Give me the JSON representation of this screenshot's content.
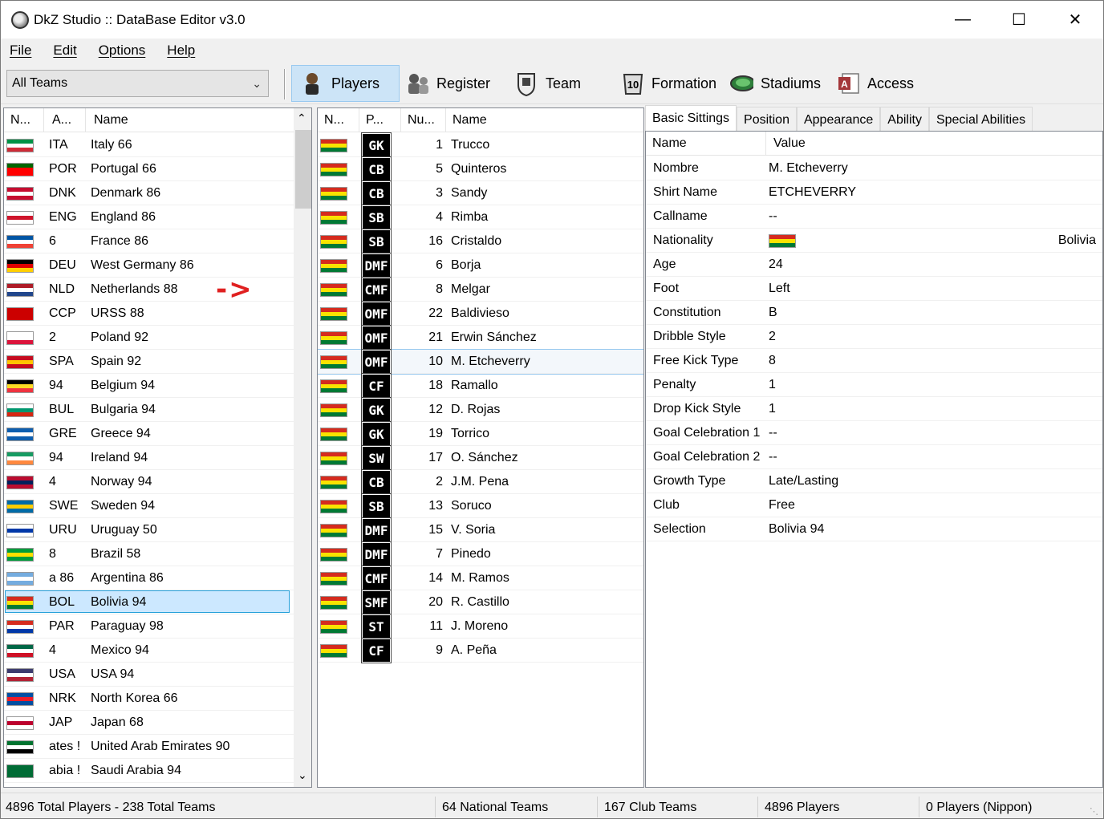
{
  "window": {
    "title": "DkZ Studio :: DataBase Editor v3.0",
    "minimize": "—",
    "maximize": "☐",
    "close": "✕"
  },
  "menu": [
    "File",
    "Edit",
    "Options",
    "Help"
  ],
  "toolbar": {
    "combo_value": "All Teams",
    "buttons": [
      {
        "label": "Players",
        "icon": "player-icon",
        "active": true
      },
      {
        "label": "Register",
        "icon": "register-icon"
      },
      {
        "label": "Team",
        "icon": "team-badge-icon"
      },
      {
        "label": "Formation",
        "icon": "formation-icon"
      },
      {
        "label": "Stadiums",
        "icon": "stadium-icon"
      },
      {
        "label": "Access",
        "icon": "access-icon"
      }
    ]
  },
  "teams": {
    "headers": [
      "N...",
      "A...",
      "Name"
    ],
    "rows": [
      {
        "abbr": "ITA",
        "name": "Italy 66",
        "flag": [
          "#009246",
          "#ffffff",
          "#ce2b37"
        ]
      },
      {
        "abbr": "POR",
        "name": "Portugal 66",
        "flag": [
          "#006600",
          "#ff0000",
          "#ff0000"
        ]
      },
      {
        "abbr": "DNK",
        "name": "Denmark 86",
        "flag": [
          "#c60c30",
          "#ffffff",
          "#c60c30"
        ]
      },
      {
        "abbr": "ENG",
        "name": "England 86",
        "flag": [
          "#ffffff",
          "#cf142b",
          "#ffffff"
        ]
      },
      {
        "abbr": "6",
        "name": "France 86",
        "flag": [
          "#0055a4",
          "#ffffff",
          "#ef4135"
        ]
      },
      {
        "abbr": "DEU",
        "name": "West Germany 86",
        "flag": [
          "#000000",
          "#dd0000",
          "#ffce00"
        ]
      },
      {
        "abbr": "NLD",
        "name": "Netherlands 88",
        "flag": [
          "#ae1c28",
          "#ffffff",
          "#21468b"
        ]
      },
      {
        "abbr": "CCP",
        "name": "URSS 88",
        "flag": [
          "#cc0000",
          "#cc0000",
          "#cc0000"
        ]
      },
      {
        "abbr": "2",
        "name": "Poland 92",
        "flag": [
          "#ffffff",
          "#ffffff",
          "#dc143c"
        ]
      },
      {
        "abbr": "SPA",
        "name": "Spain 92",
        "flag": [
          "#c60b1e",
          "#ffc400",
          "#c60b1e"
        ]
      },
      {
        "abbr": "94",
        "name": "Belgium 94",
        "flag": [
          "#000000",
          "#fdda24",
          "#ef3340"
        ]
      },
      {
        "abbr": "BUL",
        "name": "Bulgaria 94",
        "flag": [
          "#ffffff",
          "#00966e",
          "#d62612"
        ]
      },
      {
        "abbr": "GRE",
        "name": "Greece 94",
        "flag": [
          "#0d5eaf",
          "#ffffff",
          "#0d5eaf"
        ]
      },
      {
        "abbr": "94",
        "name": "Ireland 94",
        "flag": [
          "#169b62",
          "#ffffff",
          "#ff883e"
        ]
      },
      {
        "abbr": "4",
        "name": "Norway 94",
        "flag": [
          "#ba0c2f",
          "#00205b",
          "#ba0c2f"
        ]
      },
      {
        "abbr": "SWE",
        "name": "Sweden 94",
        "flag": [
          "#006aa7",
          "#fecc00",
          "#006aa7"
        ]
      },
      {
        "abbr": "URU",
        "name": "Uruguay 50",
        "flag": [
          "#ffffff",
          "#0038a8",
          "#ffffff"
        ]
      },
      {
        "abbr": "8",
        "name": "Brazil 58",
        "flag": [
          "#009c3b",
          "#ffdf00",
          "#009c3b"
        ]
      },
      {
        "abbr": "a 86",
        "name": "Argentina 86",
        "flag": [
          "#74acdf",
          "#ffffff",
          "#74acdf"
        ]
      },
      {
        "abbr": "BOL",
        "name": "Bolivia 94",
        "flag": [
          "#d52b1e",
          "#f9e300",
          "#007934"
        ],
        "selected": true
      },
      {
        "abbr": "PAR",
        "name": "Paraguay 98",
        "flag": [
          "#d52b1e",
          "#ffffff",
          "#0038a8"
        ]
      },
      {
        "abbr": "4",
        "name": "Mexico 94",
        "flag": [
          "#006847",
          "#ffffff",
          "#ce1126"
        ]
      },
      {
        "abbr": "USA",
        "name": "USA 94",
        "flag": [
          "#3c3b6e",
          "#ffffff",
          "#b22234"
        ]
      },
      {
        "abbr": "NRK",
        "name": "North Korea 66",
        "flag": [
          "#024fa2",
          "#ed1c27",
          "#024fa2"
        ]
      },
      {
        "abbr": "JAP",
        "name": "Japan 68",
        "flag": [
          "#ffffff",
          "#bc002d",
          "#ffffff"
        ]
      },
      {
        "abbr": "ates !",
        "name": "United Arab Emirates 90",
        "flag": [
          "#00732f",
          "#ffffff",
          "#000000"
        ]
      },
      {
        "abbr": "abia !",
        "name": "Saudi Arabia 94",
        "flag": [
          "#006c35",
          "#006c35",
          "#006c35"
        ]
      }
    ]
  },
  "annotation_arrow": "->",
  "players": {
    "headers": [
      "N...",
      "P...",
      "Nu...",
      "Name"
    ],
    "flag": [
      "#d52b1e",
      "#f9e300",
      "#007934"
    ],
    "rows": [
      {
        "pos": "GK",
        "num": "1",
        "name": "Trucco"
      },
      {
        "pos": "CB",
        "num": "5",
        "name": "Quinteros"
      },
      {
        "pos": "CB",
        "num": "3",
        "name": "Sandy"
      },
      {
        "pos": "SB",
        "num": "4",
        "name": "Rimba"
      },
      {
        "pos": "SB",
        "num": "16",
        "name": "Cristaldo"
      },
      {
        "pos": "DMF",
        "num": "6",
        "name": "Borja"
      },
      {
        "pos": "CMF",
        "num": "8",
        "name": "Melgar"
      },
      {
        "pos": "OMF",
        "num": "22",
        "name": "Baldivieso"
      },
      {
        "pos": "OMF",
        "num": "21",
        "name": "Erwin Sánchez"
      },
      {
        "pos": "OMF",
        "num": "10",
        "name": "M. Etcheverry",
        "selected": true
      },
      {
        "pos": "CF",
        "num": "18",
        "name": "Ramallo"
      },
      {
        "pos": "GK",
        "num": "12",
        "name": "D. Rojas"
      },
      {
        "pos": "GK",
        "num": "19",
        "name": "Torrico"
      },
      {
        "pos": "SW",
        "num": "17",
        "name": "O. Sánchez"
      },
      {
        "pos": "CB",
        "num": "2",
        "name": "J.M. Pena"
      },
      {
        "pos": "SB",
        "num": "13",
        "name": "Soruco"
      },
      {
        "pos": "DMF",
        "num": "15",
        "name": "V. Soria"
      },
      {
        "pos": "DMF",
        "num": "7",
        "name": "Pinedo"
      },
      {
        "pos": "CMF",
        "num": "14",
        "name": "M. Ramos"
      },
      {
        "pos": "SMF",
        "num": "20",
        "name": "R. Castillo"
      },
      {
        "pos": "ST",
        "num": "11",
        "name": "J. Moreno"
      },
      {
        "pos": "CF",
        "num": "9",
        "name": "A. Peña"
      }
    ]
  },
  "tabs": [
    "Basic Sittings",
    "Position",
    "Appearance",
    "Ability",
    "Special Abilities"
  ],
  "details": {
    "headers": [
      "Name",
      "Value"
    ],
    "rows": [
      {
        "k": "Nombre",
        "v": "M. Etcheverry"
      },
      {
        "k": "Shirt Name",
        "v": "ETCHEVERRY"
      },
      {
        "k": "Callname",
        "v": "--"
      },
      {
        "k": "Nationality",
        "v": "",
        "flag": true,
        "right": "Bolivia"
      },
      {
        "k": "Age",
        "v": "24"
      },
      {
        "k": "Foot",
        "v": "Left"
      },
      {
        "k": "Constitution",
        "v": "B"
      },
      {
        "k": "Dribble Style",
        "v": "2"
      },
      {
        "k": "Free Kick Type",
        "v": "8"
      },
      {
        "k": "Penalty",
        "v": "1"
      },
      {
        "k": "Drop Kick Style",
        "v": "1"
      },
      {
        "k": "Goal Celebration 1",
        "v": "--"
      },
      {
        "k": "Goal Celebration 2",
        "v": "--"
      },
      {
        "k": "Growth Type",
        "v": "Late/Lasting"
      },
      {
        "k": "Club",
        "v": "Free"
      },
      {
        "k": "Selection",
        "v": "Bolivia 94"
      }
    ]
  },
  "status": [
    "4896 Total Players  -  238 Total Teams",
    "64 National Teams",
    "167 Club Teams",
    "4896 Players",
    "0 Players (Nippon)"
  ]
}
